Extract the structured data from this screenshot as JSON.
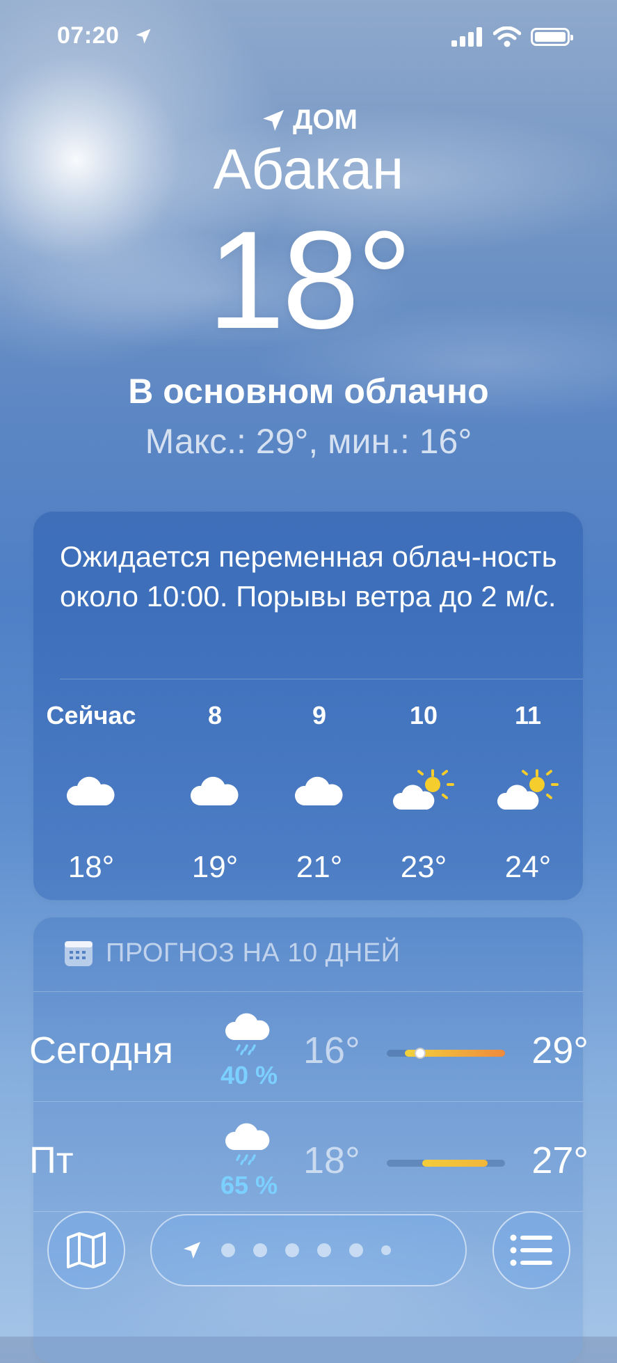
{
  "status_bar": {
    "time": "07:20",
    "location_active": true
  },
  "header": {
    "home_label": "ДОМ",
    "city": "Абакан",
    "temperature": "18°",
    "condition": "В основном облачно",
    "high_low": "Макс.: 29°, мин.: 16°"
  },
  "hourly": {
    "summary": "Ожидается переменная облач-ность около 10:00. Порывы ветра до 2 м/с.",
    "hours": [
      {
        "label": "Сейчас",
        "icon": "cloud-icon",
        "temp": "18°"
      },
      {
        "label": "8",
        "icon": "cloud-icon",
        "temp": "19°"
      },
      {
        "label": "9",
        "icon": "cloud-icon",
        "temp": "21°"
      },
      {
        "label": "10",
        "icon": "partly-sunny-icon",
        "temp": "23°"
      },
      {
        "label": "11",
        "icon": "partly-sunny-icon",
        "temp": "24°"
      }
    ]
  },
  "forecast": {
    "title": "ПРОГНОЗ НА 10 ДНЕЙ",
    "days": [
      {
        "name": "Сегодня",
        "icon": "cloud-rain-icon",
        "pop": "40 %",
        "low": "16°",
        "high": "29°",
        "current_marker": true,
        "range_start": 0.15,
        "range_end": 1.0,
        "colors": [
          "#f0d23c",
          "#f08a3c"
        ]
      },
      {
        "name": "Пт",
        "icon": "cloud-rain-icon",
        "pop": "65 %",
        "low": "18°",
        "high": "27°",
        "current_marker": false,
        "range_start": 0.3,
        "range_end": 0.85,
        "colors": [
          "#f2cc3a",
          "#f2b63a"
        ]
      }
    ]
  },
  "toolbar": {
    "map_icon": "map-icon",
    "list_icon": "list-icon",
    "page_dots": 6
  }
}
